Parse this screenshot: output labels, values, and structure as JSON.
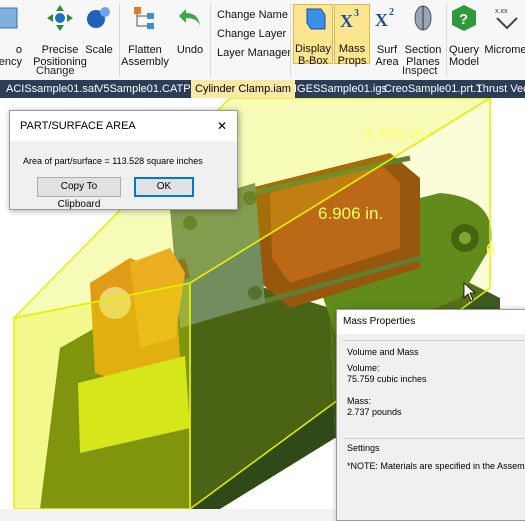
{
  "ribbon": {
    "items": [
      {
        "label": "o",
        "label2": "ency",
        "icon": "transparency-icon"
      },
      {
        "label": "Precise",
        "label2": "Positioning",
        "icon": "precise-positioning-icon"
      },
      {
        "label": "Scale",
        "icon": "scale-icon"
      },
      {
        "label": "Flatten",
        "label2": "Assembly",
        "icon": "flatten-assembly-icon"
      },
      {
        "label": "Undo",
        "icon": "undo-icon"
      },
      {
        "label": "Display",
        "label2": "B-Box",
        "icon": "display-bbox-icon"
      },
      {
        "label": "Mass",
        "label2": "Props",
        "icon": "mass-props-icon"
      },
      {
        "label": "Surf",
        "label2": "Area",
        "icon": "surf-area-icon"
      },
      {
        "label": "Section",
        "label2": "Planes",
        "icon": "section-planes-icon"
      },
      {
        "label": "Query",
        "label2": "Model",
        "icon": "query-model-icon"
      },
      {
        "label": "Micromet",
        "icon": "micrometer-icon"
      }
    ],
    "list_items": [
      "Change Name",
      "Change Layer",
      "Layer Manager"
    ],
    "groups": {
      "change": "Change",
      "inspect": "Inspect"
    }
  },
  "tabs": [
    "ACISsample01.sat",
    "V5Sample01.CATPart",
    "Cylinder Clamp.iam",
    "IGESSample01.igs",
    "CreoSample01.prt.1",
    "Thrust Vecto"
  ],
  "active_tab": 2,
  "viewport": {
    "dimensions": [
      "3.465 in.",
      "6.906 in.",
      "6"
    ],
    "bbox_color": "#e4f000"
  },
  "surface_dialog": {
    "title": "PART/SURFACE AREA",
    "message": "Area of part/surface = 113.528 square inches",
    "copy_button": "Copy To Clipboard",
    "ok_button": "OK",
    "close_glyph": "✕"
  },
  "mass_dialog": {
    "title": "Mass Properties",
    "section_volume_mass": "Volume and Mass",
    "volume_label": "Volume:",
    "volume_value": "75.759  cubic inches",
    "mass_label": "Mass:",
    "mass_value": "2.737 pounds",
    "section_settings": "Settings",
    "note": "*NOTE: Materials are specified in the Assemb"
  },
  "colors": {
    "tab_bar": "#2c3d57",
    "active_tab": "#fae9a4",
    "active_ribbon": "#fbe68f"
  }
}
